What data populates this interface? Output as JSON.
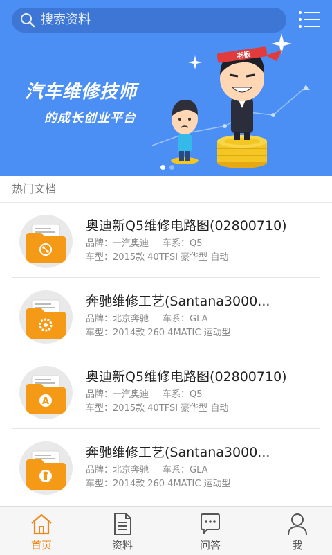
{
  "search": {
    "placeholder": "搜索资料"
  },
  "banner": {
    "line1": "汽车维修技师",
    "line2": "的成长创业平台",
    "boss_tag": "老板",
    "pages": 2,
    "active_page": 1
  },
  "section": {
    "title": "热门文档"
  },
  "docs": [
    {
      "icon": "flow-icon",
      "title": "奥迪新Q5维修电路图(02800710)",
      "brand_label": "品牌：",
      "brand": "一汽奥迪",
      "series_label": "车系：",
      "series": "Q5",
      "model_label": "车型：",
      "model": "2015款 40TFSI 豪华型 自动"
    },
    {
      "icon": "gear-icon",
      "title": "奔驰维修工艺(Santana3000...",
      "brand_label": "品牌：",
      "brand": "北京奔驰",
      "series_label": "车系：",
      "series": "GLA",
      "model_label": "车型：",
      "model": "2014款 260 4MATIC 运动型"
    },
    {
      "icon": "letter-a-icon",
      "title": "奥迪新Q5维修电路图(02800710)",
      "brand_label": "品牌：",
      "brand": "一汽奥迪",
      "series_label": "车系：",
      "series": "Q5",
      "model_label": "车型：",
      "model": "2015款 40TFSI 豪华型 自动"
    },
    {
      "icon": "wrench-icon",
      "title": "奔驰维修工艺(Santana3000...",
      "brand_label": "品牌：",
      "brand": "北京奔驰",
      "series_label": "车系：",
      "series": "GLA",
      "model_label": "车型：",
      "model": "2014款 260 4MATIC 运动型"
    }
  ],
  "tabs": [
    {
      "label": "首页",
      "icon": "home-icon",
      "active": true
    },
    {
      "label": "资料",
      "icon": "document-icon",
      "active": false
    },
    {
      "label": "问答",
      "icon": "chat-bubble-icon",
      "active": false
    },
    {
      "label": "我",
      "icon": "user-icon",
      "active": false
    }
  ],
  "colors": {
    "banner_bg": "#4b8ff5",
    "accent": "#f08519",
    "folder_orange": "#f59a16",
    "tab_inactive": "#555555"
  }
}
